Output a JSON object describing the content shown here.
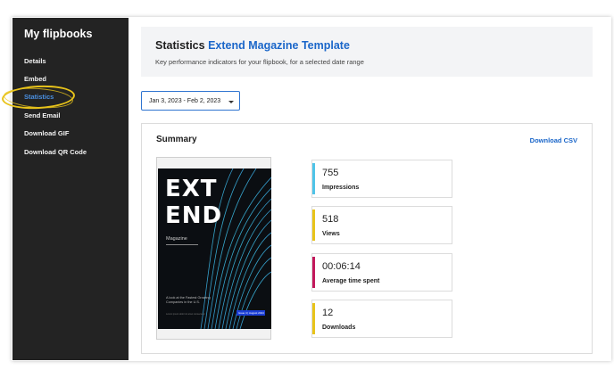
{
  "sidebar": {
    "title": "My flipbooks",
    "items": [
      {
        "label": "Details"
      },
      {
        "label": "Embed"
      },
      {
        "label": "Statistics"
      },
      {
        "label": "Send Email"
      },
      {
        "label": "Download GIF"
      },
      {
        "label": "Download QR Code"
      }
    ],
    "active_color": "#4a90e2",
    "highlight_color": "#e8c31a"
  },
  "header": {
    "title_prefix": "Statistics",
    "title_accent": "Extend Magazine Template",
    "subtitle": "Key performance indicators for your flipbook, for a selected date range",
    "accent_color": "#1a66c9"
  },
  "date_range": {
    "value": "Jan 3, 2023 - Feb 2, 2023",
    "icon": "chevron-down-icon"
  },
  "summary": {
    "title": "Summary",
    "download_label": "Download CSV",
    "cover": {
      "line1": "EXT",
      "line2": "END",
      "sub": "Magazine",
      "tagline": "A look at the Fastest Growing Companies in the U.S.",
      "small": "Lorem ipsum dolor sit amet consectetur",
      "badge": "Issue 4 | August 2024"
    },
    "kpis": [
      {
        "value": "755",
        "label": "Impressions",
        "color": "#4fc3e8"
      },
      {
        "value": "518",
        "label": "Views",
        "color": "#e8c31a"
      },
      {
        "value": "00:06:14",
        "label": "Average time spent",
        "color": "#c2185b"
      },
      {
        "value": "12",
        "label": "Downloads",
        "color": "#e8c31a"
      }
    ]
  }
}
